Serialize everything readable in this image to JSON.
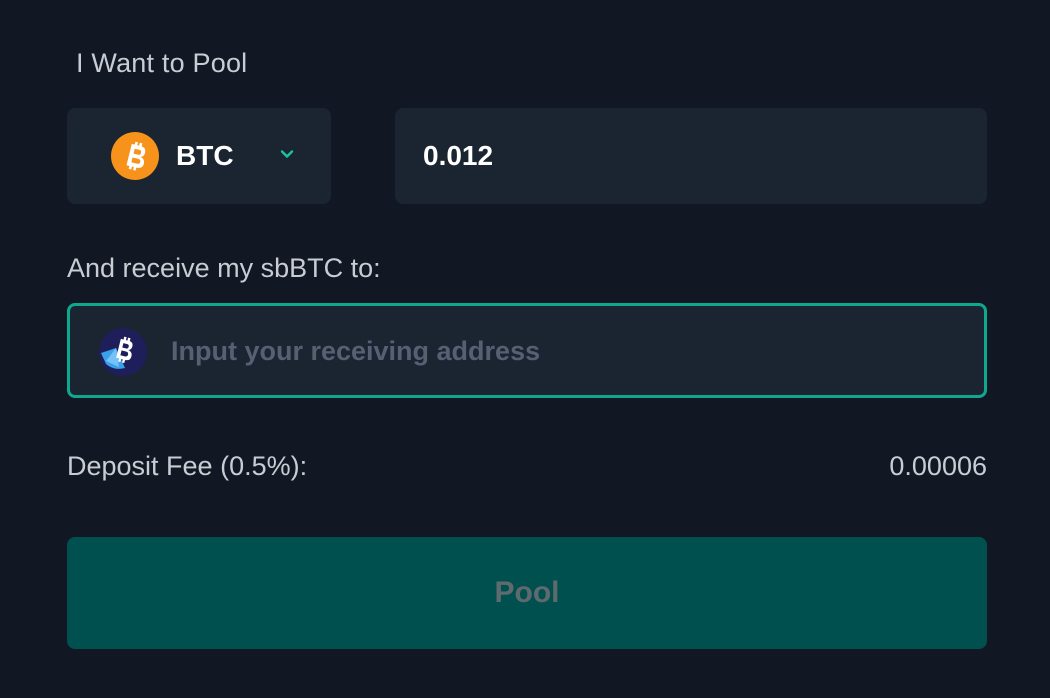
{
  "form": {
    "title": "I Want to Pool",
    "token": {
      "symbol": "BTC",
      "icon": "bitcoin-icon",
      "icon_color": "#F7931A"
    },
    "amount": {
      "value": "0.012"
    },
    "receive_label": "And receive my sbBTC to:",
    "address": {
      "placeholder": "Input your receiving address",
      "value": "",
      "icon": "sbbtc-icon"
    },
    "fee": {
      "label": "Deposit Fee (0.5%):",
      "value": "0.00006"
    },
    "submit_label": "Pool"
  },
  "colors": {
    "background": "#111723",
    "panel": "#1b2431",
    "accent": "#0fa88e",
    "button": "#00504f",
    "button_text_disabled": "#5f6a6f"
  }
}
